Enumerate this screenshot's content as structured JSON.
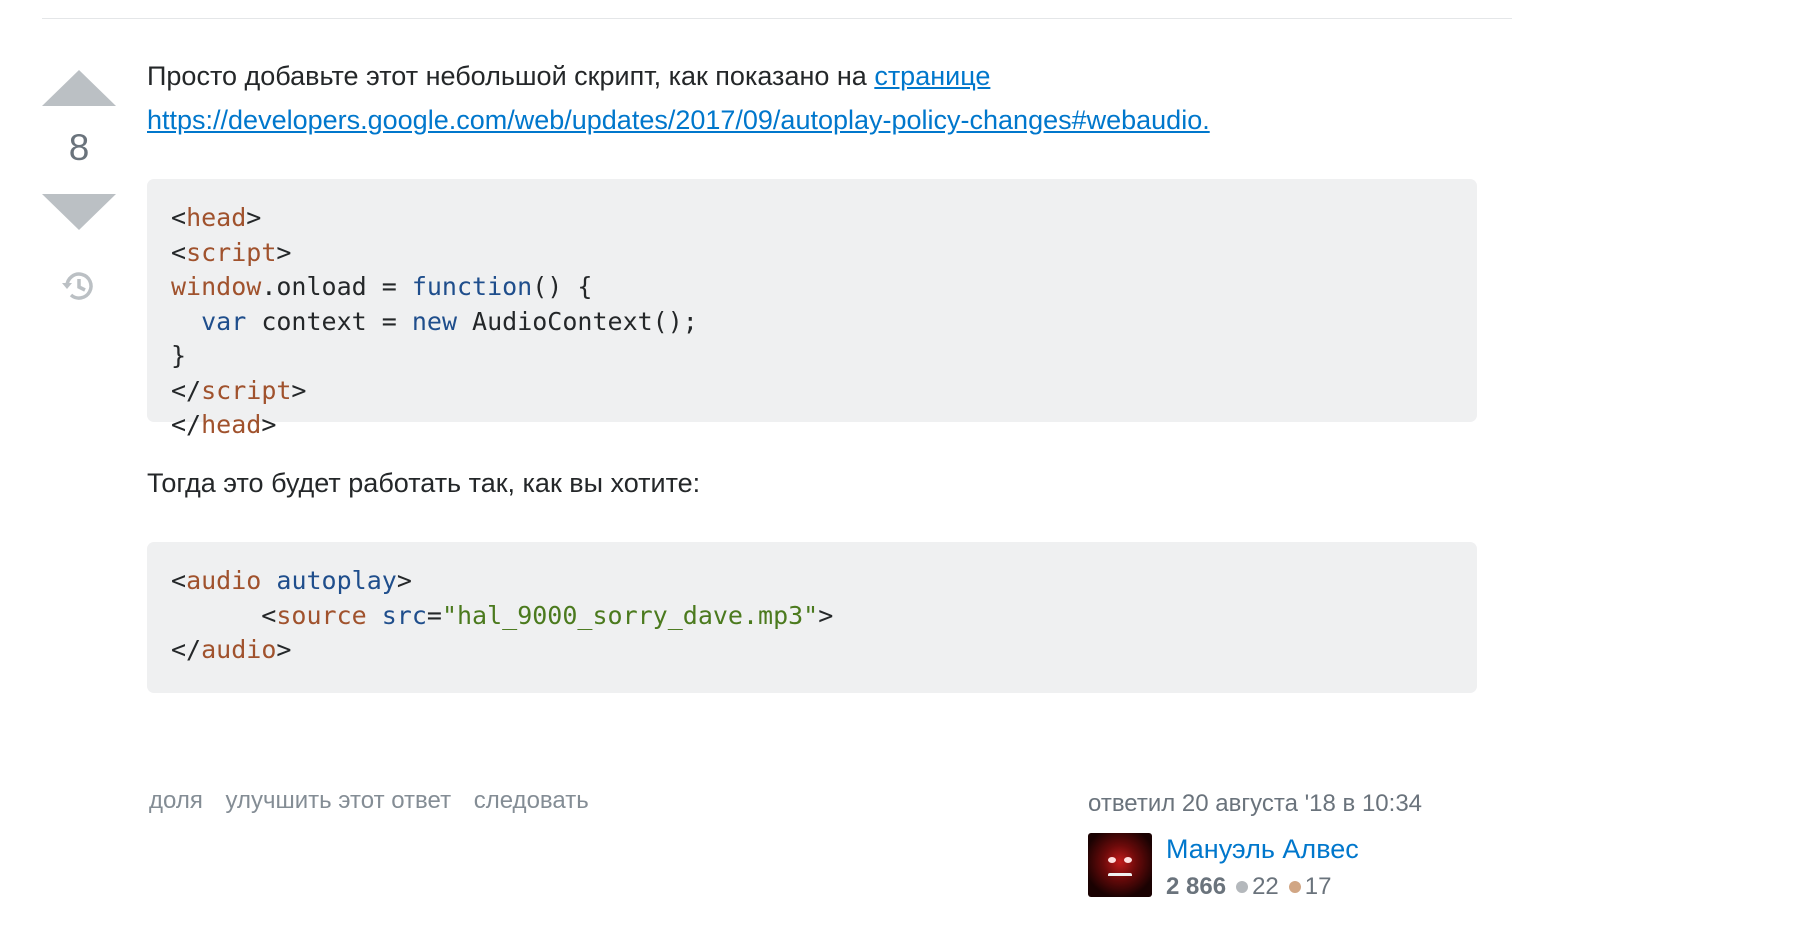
{
  "vote": {
    "count": "8"
  },
  "answer": {
    "intro_text": "Просто добавьте этот небольшой скрипт, как показано на ",
    "intro_link_text": "странице",
    "url_link": "https://developers.google.com/web/updates/2017/09/autoplay-policy-changes#webaudio.",
    "middle_text": "Тогда это будет работать так, как вы хотите:"
  },
  "post_menu": {
    "share": "доля",
    "improve": "улучшить этот ответ",
    "follow": "следовать"
  },
  "signature": {
    "action_time": "ответил 20 августа '18 в 10:34",
    "user_name": "Мануэль Алвес",
    "reputation": "2 866",
    "silver_badges": "22",
    "bronze_badges": "17"
  },
  "colors": {
    "link": "#0077cc",
    "vote_arrow": "#bbc0c4",
    "code_bg": "#eff0f1",
    "tag": "#a0522d",
    "keyword": "#1f4e8c",
    "string": "#4b7a1e"
  }
}
